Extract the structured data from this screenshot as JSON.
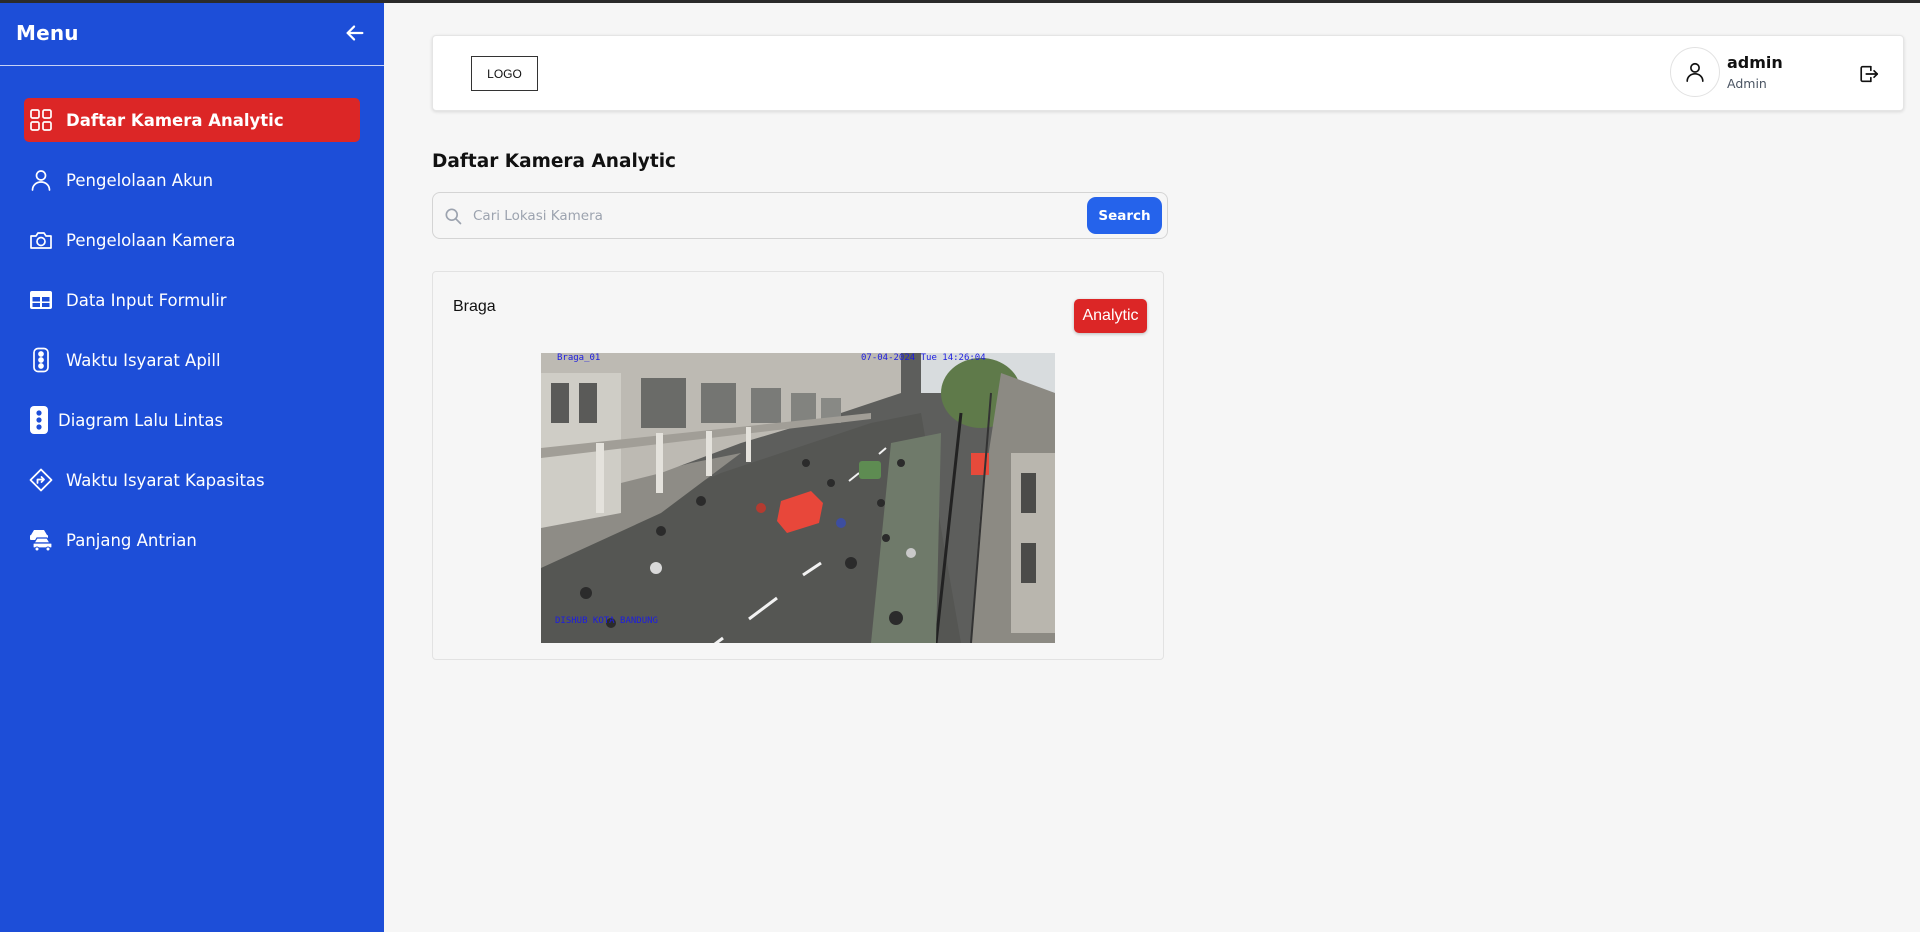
{
  "sidebar": {
    "title": "Menu",
    "collapse_icon": "arrow-left-icon",
    "items": [
      {
        "label": "Daftar Kamera Analytic",
        "icon": "grid-icon",
        "active": true
      },
      {
        "label": "Pengelolaan Akun",
        "icon": "user-icon"
      },
      {
        "label": "Pengelolaan Kamera",
        "icon": "camera-icon"
      },
      {
        "label": "Data Input Formulir",
        "icon": "table-icon"
      },
      {
        "label": "Waktu Isyarat Apill",
        "icon": "traffic-light-outline-icon"
      },
      {
        "label": "Diagram Lalu Lintas",
        "icon": "traffic-light-icon"
      },
      {
        "label": "Waktu Isyarat Kapasitas",
        "icon": "directions-sign-icon"
      },
      {
        "label": "Panjang Antrian",
        "icon": "car-queue-icon"
      }
    ]
  },
  "header": {
    "logo_text": "LOGO",
    "user": {
      "name": "admin",
      "role": "Admin"
    },
    "logout_icon": "logout-icon"
  },
  "main": {
    "title": "Daftar Kamera Analytic",
    "search": {
      "placeholder": "Cari Lokasi Kamera",
      "value": "",
      "button_label": "Search"
    },
    "cameras": [
      {
        "name": "Braga",
        "action_label": "Analytic",
        "feed": {
          "overlay_top_left": "Braga_01",
          "overlay_top_right": "07-04-2024 Tue 14:26:04",
          "overlay_bottom_left": "DISHUB KOTA BANDUNG"
        }
      }
    ]
  },
  "colors": {
    "sidebar_bg": "#1d4ed8",
    "active_item": "#dc2626",
    "search_button": "#2563eb",
    "analytic_button": "#dc2626"
  }
}
